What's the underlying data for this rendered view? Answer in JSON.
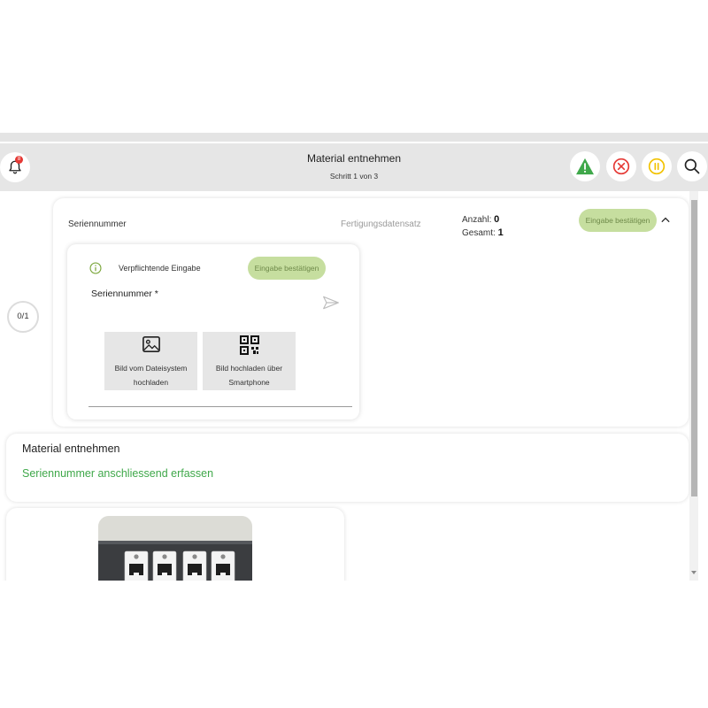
{
  "header": {
    "title": "Material entnehmen",
    "subtitle": "Schritt 1 von 3",
    "notification_count": "8",
    "colors": {
      "warning": "#3fa84a",
      "cancel": "#e53935",
      "pause": "#f2c200"
    },
    "icons": [
      "bell-icon",
      "warning-icon",
      "cancel-icon",
      "pause-icon",
      "search-icon"
    ]
  },
  "step": {
    "progress": "0/1"
  },
  "card1": {
    "label": "Seriennummer",
    "fertigung": "Fertigungsdatensatz",
    "anzahl_label": "Anzahl:",
    "anzahl_value": "0",
    "gesamt_label": "Gesamt:",
    "gesamt_value": "1",
    "confirm_label": "Eingabe bestätigen"
  },
  "inner": {
    "mandatory": "Verpflichtende Eingabe",
    "confirm_label": "Eingabe bestätigen",
    "field_label": "Seriennummer *",
    "upload_file_1": "Bild vom Dateisystem",
    "upload_file_2": "hochladen",
    "upload_phone_1": "Bild hochladen über",
    "upload_phone_2": "Smartphone"
  },
  "card2": {
    "title": "Material entnehmen",
    "instruction": "Seriennummer anschliessend erfassen"
  },
  "colors": {
    "accent_green": "#3fa84a",
    "pill_bg": "#c6de9f",
    "pill_text": "#6f8a4a"
  }
}
